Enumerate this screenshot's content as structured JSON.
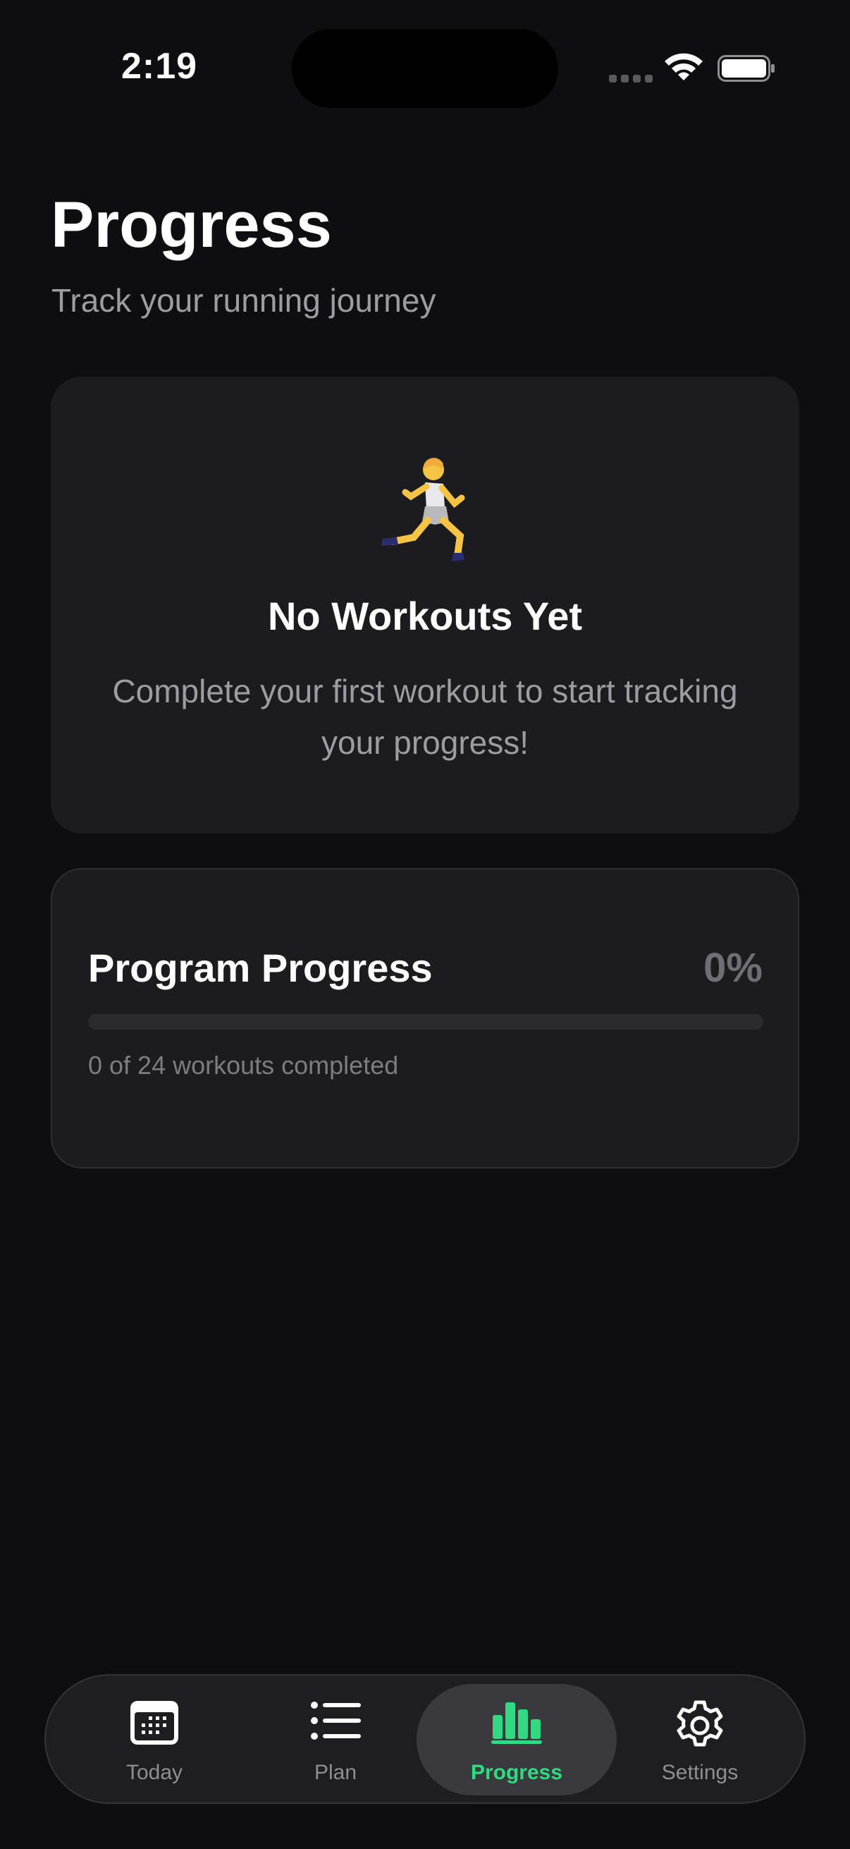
{
  "status_bar": {
    "time": "2:19"
  },
  "header": {
    "title": "Progress",
    "subtitle": "Track your running journey"
  },
  "empty_state": {
    "icon": "runner-emoji",
    "title": "No Workouts Yet",
    "message": "Complete your first workout to start tracking your progress!"
  },
  "program_progress": {
    "title": "Program Progress",
    "percent_label": "0%",
    "percent_value": 0,
    "caption": "0 of 24 workouts completed",
    "completed": 0,
    "total": 24
  },
  "tab_bar": {
    "tabs": [
      {
        "label": "Today",
        "icon": "calendar-icon",
        "active": false
      },
      {
        "label": "Plan",
        "icon": "list-icon",
        "active": false
      },
      {
        "label": "Progress",
        "icon": "bar-chart-icon",
        "active": true
      },
      {
        "label": "Settings",
        "icon": "gear-icon",
        "active": false
      }
    ]
  },
  "colors": {
    "background": "#0e0e10",
    "card": "#1c1c1e",
    "accent": "#30d982",
    "secondary_text": "#9c9ca3"
  }
}
